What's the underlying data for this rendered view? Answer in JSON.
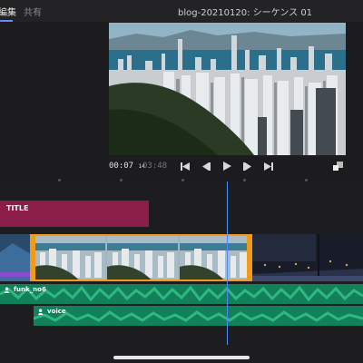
{
  "header": {
    "tab_edit": "編集",
    "tab_share": "共有",
    "sequence_title": "blog-20210120: シーケンス 01"
  },
  "transport": {
    "current_time": "00:07",
    "current_frames": "14",
    "total_time": "03:48",
    "buttons": [
      "skip-to-start",
      "step-back",
      "play",
      "step-forward",
      "skip-to-end"
    ]
  },
  "timeline": {
    "title_clip": "TITLE",
    "audio_tracks": [
      {
        "name": "funk_no6"
      },
      {
        "name": "voice"
      }
    ]
  },
  "colors": {
    "title_clip": "#8b1e48",
    "selection": "#f29a1a",
    "audio": "#12805a",
    "playhead": "#4a8cff"
  }
}
